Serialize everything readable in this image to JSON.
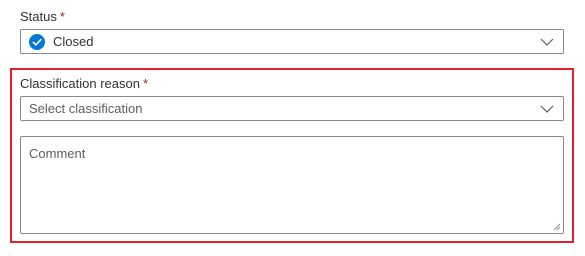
{
  "status": {
    "label": "Status",
    "required_mark": "*",
    "value": "Closed",
    "icon": "check-circle-icon",
    "icon_color": "#0078d4"
  },
  "classification": {
    "label": "Classification reason",
    "required_mark": "*",
    "placeholder": "Select classification"
  },
  "comment": {
    "placeholder": "Comment"
  },
  "highlight_color": "#e3202e"
}
